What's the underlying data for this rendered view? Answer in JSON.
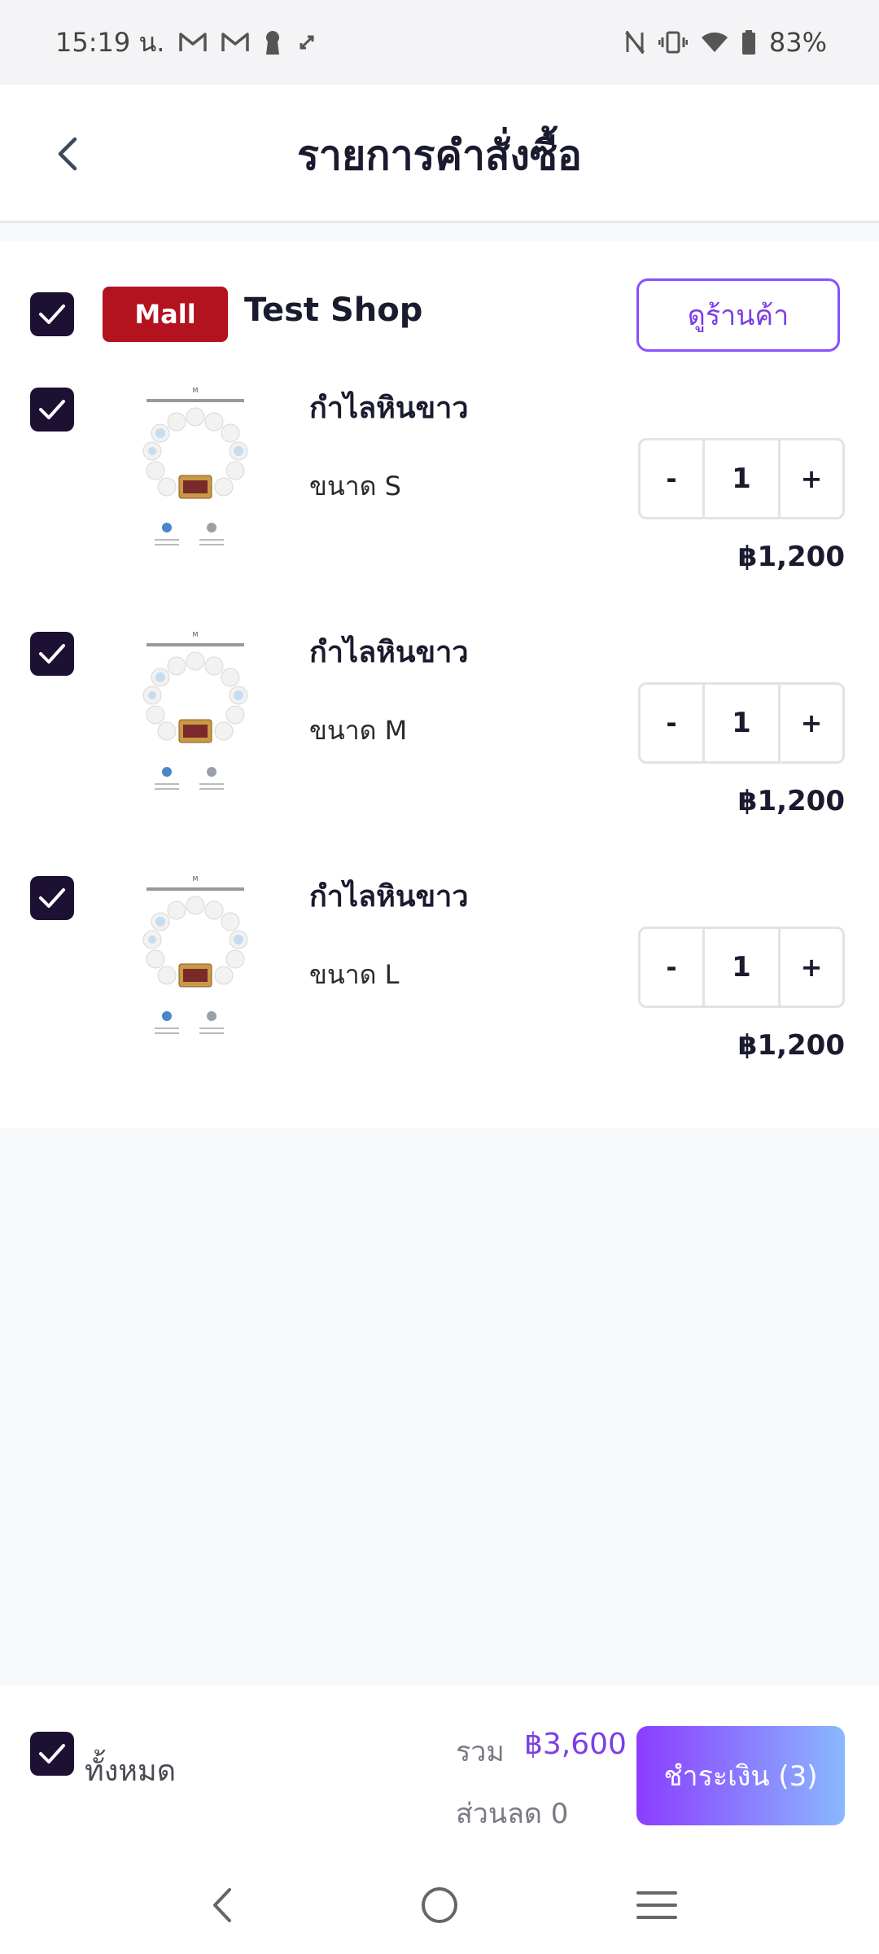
{
  "status_bar": {
    "time": "15:19 น.",
    "battery": "83%",
    "icons": [
      "gmail-icon",
      "gmail-icon",
      "keyhole-icon",
      "sync-icon",
      "nfc-icon",
      "vibrate-icon",
      "wifi-icon",
      "battery-icon"
    ]
  },
  "header": {
    "title": "รายการคำสั่งซื้อ",
    "back_icon": "chevron-left-icon"
  },
  "shop": {
    "badge": "Mall",
    "name": "Test Shop",
    "view_shop_label": "ดูร้านค้า",
    "checked": true
  },
  "items": [
    {
      "name": "กำไลหินขาว",
      "variant": "ขนาด S",
      "quantity": "1",
      "price": "฿1,200",
      "checked": true
    },
    {
      "name": "กำไลหินขาว",
      "variant": "ขนาด M",
      "quantity": "1",
      "price": "฿1,200",
      "checked": true
    },
    {
      "name": "กำไลหินขาว",
      "variant": "ขนาด L",
      "quantity": "1",
      "price": "฿1,200",
      "checked": true
    }
  ],
  "stepper": {
    "minus": "-",
    "plus": "+"
  },
  "summary": {
    "select_all_label": "ทั้งหมด",
    "total_label": "รวม",
    "total_value": "฿3,600",
    "discount_text": "ส่วนลด 0",
    "checkout_label": "ชำระเงิน (3)"
  },
  "colors": {
    "accent": "#7b3fe4",
    "checkbox": "#1c1033",
    "mall_badge": "#b3121f",
    "checkout_gradient_start": "#8b3dff",
    "checkout_gradient_end": "#8ab8ff"
  }
}
